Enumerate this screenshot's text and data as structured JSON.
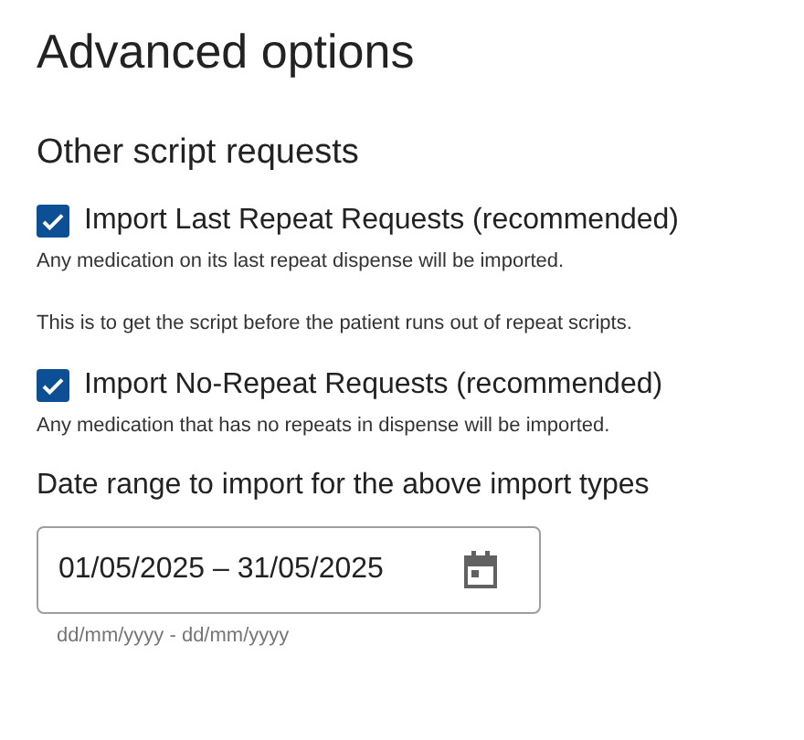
{
  "title": "Advanced options",
  "section": {
    "heading": "Other script requests",
    "options": [
      {
        "label": "Import Last Repeat Requests (recommended)",
        "checked": true,
        "description": [
          "Any medication on its last repeat dispense will be imported.",
          "This is to get the script before the patient runs out of repeat scripts."
        ]
      },
      {
        "label": "Import No-Repeat Requests (recommended)",
        "checked": true,
        "description": [
          "Any medication that has no repeats in dispense will be imported."
        ]
      }
    ]
  },
  "date_range": {
    "label": "Date range to import for the above import types",
    "value": "01/05/2025 – 31/05/2025",
    "hint": "dd/mm/yyyy - dd/mm/yyyy"
  }
}
